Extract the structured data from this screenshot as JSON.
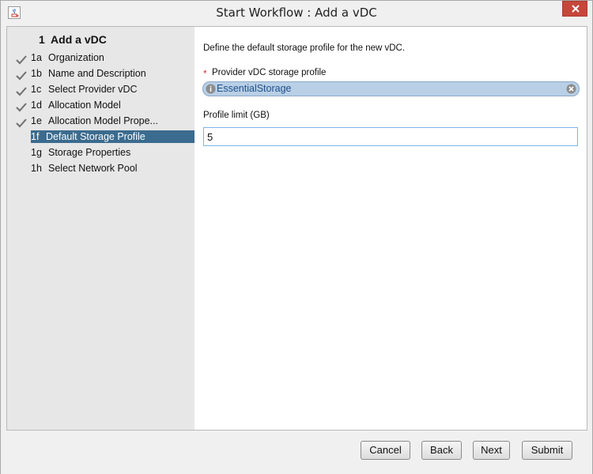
{
  "window": {
    "title": "Start Workflow : Add a vDC",
    "app_icon": "java-icon",
    "close_icon": "close-icon"
  },
  "sidebar": {
    "header": "1  Add a vDC",
    "items": [
      {
        "num": "1a",
        "label": "Organization",
        "done": true,
        "active": false
      },
      {
        "num": "1b",
        "label": "Name and Description",
        "done": true,
        "active": false
      },
      {
        "num": "1c",
        "label": "Select Provider vDC",
        "done": true,
        "active": false
      },
      {
        "num": "1d",
        "label": "Allocation Model",
        "done": true,
        "active": false
      },
      {
        "num": "1e",
        "label": "Allocation Model Prope...",
        "done": true,
        "active": false
      },
      {
        "num": "1f",
        "label": "Default Storage Profile",
        "done": false,
        "active": true
      },
      {
        "num": "1g",
        "label": "Storage Properties",
        "done": false,
        "active": false
      },
      {
        "num": "1h",
        "label": "Select Network Pool",
        "done": false,
        "active": false
      }
    ]
  },
  "main": {
    "intro": "Define the default storage profile for the new vDC.",
    "required_marker": "*",
    "storage_profile_label": "Provider vDC storage profile",
    "storage_profile_value": "EssentialStorage",
    "profile_limit_label": "Profile limit (GB)",
    "profile_limit_value": "5"
  },
  "footer": {
    "cancel": "Cancel",
    "back": "Back",
    "next": "Next",
    "submit": "Submit"
  },
  "colors": {
    "active_step_bg": "#3b6b8e",
    "chip_bg": "#b8cfe6",
    "chip_text": "#1f4f8a",
    "required_star": "#c8343b",
    "close_button": "#c7463a"
  }
}
